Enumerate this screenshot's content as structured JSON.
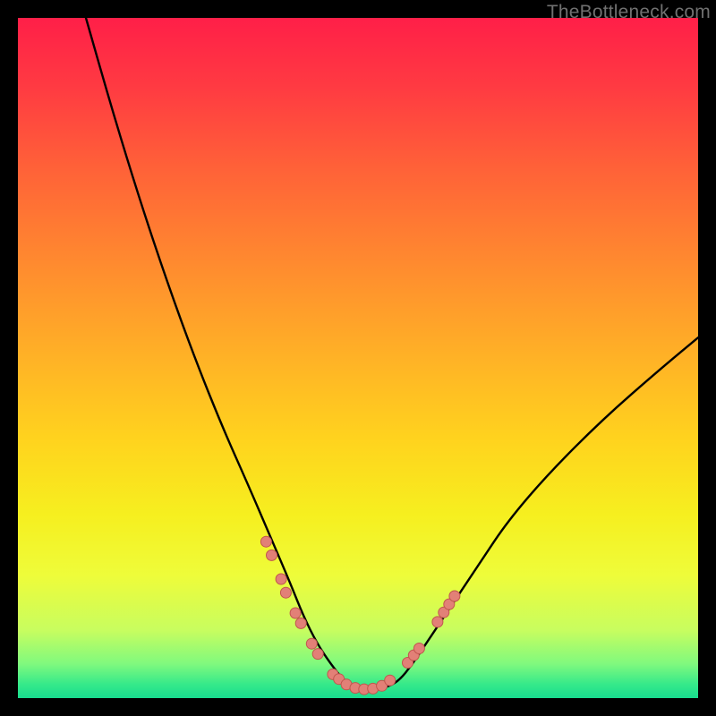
{
  "watermark": "TheBottleneck.com",
  "palette": {
    "frame": "#000000",
    "curve": "#000000",
    "dot_fill": "#e28077",
    "dot_stroke": "#c1564e"
  },
  "chart_data": {
    "type": "line",
    "title": "",
    "xlabel": "",
    "ylabel": "",
    "xlim": [
      0,
      100
    ],
    "ylim": [
      0,
      100
    ],
    "grid": false,
    "legend": false,
    "note": "V-shaped bottleneck curve over a heat gradient. Values are read off pixel positions; x≈horizontal %, y≈height % (0 = bottom green band, 100 = top edge).",
    "series": [
      {
        "name": "bottleneck-curve",
        "x": [
          10,
          14,
          18,
          22,
          26,
          30,
          34,
          37,
          40,
          42,
          44,
          46,
          48,
          50,
          52,
          54,
          56,
          58,
          60,
          64,
          68,
          72,
          78,
          86,
          94,
          100
        ],
        "y": [
          100,
          86,
          73,
          61,
          50,
          40,
          31,
          24,
          17,
          12,
          8,
          5,
          2.5,
          1.5,
          1.2,
          1.5,
          2.5,
          5,
          8,
          14,
          20,
          26,
          33,
          41,
          48,
          53
        ]
      }
    ],
    "markers": {
      "name": "highlight-dots",
      "note": "Salmon dots clustered on both flanks of the valley near the green band.",
      "points": [
        {
          "x": 36.5,
          "y": 23
        },
        {
          "x": 37.3,
          "y": 21
        },
        {
          "x": 38.7,
          "y": 17.5
        },
        {
          "x": 39.4,
          "y": 15.5
        },
        {
          "x": 40.8,
          "y": 12.5
        },
        {
          "x": 41.6,
          "y": 11
        },
        {
          "x": 43.2,
          "y": 8
        },
        {
          "x": 44.1,
          "y": 6.5
        },
        {
          "x": 46.3,
          "y": 3.5
        },
        {
          "x": 47.2,
          "y": 2.8
        },
        {
          "x": 48.3,
          "y": 2.0
        },
        {
          "x": 49.6,
          "y": 1.5
        },
        {
          "x": 50.9,
          "y": 1.3
        },
        {
          "x": 52.2,
          "y": 1.4
        },
        {
          "x": 53.5,
          "y": 1.8
        },
        {
          "x": 54.7,
          "y": 2.6
        },
        {
          "x": 57.3,
          "y": 5.2
        },
        {
          "x": 58.2,
          "y": 6.3
        },
        {
          "x": 59.0,
          "y": 7.3
        },
        {
          "x": 61.7,
          "y": 11.2
        },
        {
          "x": 62.6,
          "y": 12.6
        },
        {
          "x": 63.4,
          "y": 13.8
        },
        {
          "x": 64.2,
          "y": 15.0
        }
      ],
      "radius_px": 6
    }
  }
}
